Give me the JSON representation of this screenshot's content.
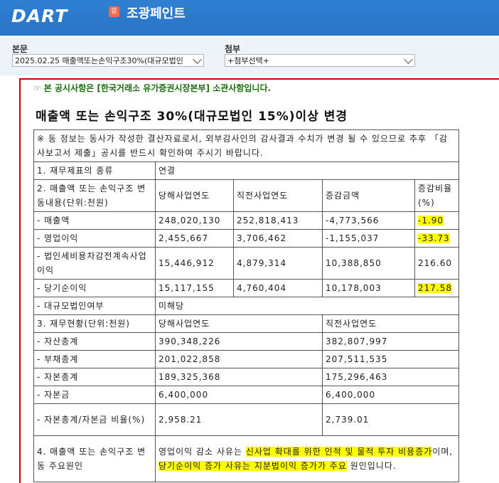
{
  "header": {
    "logo": "DART",
    "company_badge": "유",
    "company_name": "조광페인트"
  },
  "toolbar": {
    "body_label": "본문",
    "body_select": "2025.02.25 매출액또는손익구조30%(대규모법인",
    "attach_label": "첨부",
    "attach_select": "+첨부선택+"
  },
  "notice": {
    "icon": "☞",
    "text": "본 공시사항은 [한국거래소 유가증권시장본부] 소관사항입니다."
  },
  "doc_title": "매출액 또는 손익구조 30%(대규모법인 15%)이상 변경",
  "table": {
    "note": "※ 동 정보는 동사가 작성한 결산자료로서, 외부감사인의 감사결과 수치가 변경 될 수 있으므로 추후 「감사보고서 제출」공시를 반드시 확인하여 주시기 바랍니다.",
    "r1_label": "1. 재무제표의 종류",
    "r1_value": "연결",
    "r2_label": "2. 매출액 또는 손익구조 변동내용(단위:천원)",
    "h_curr": "당해사업연도",
    "h_prev": "직전사업연도",
    "h_diff": "증감금액",
    "h_rate": "증감비율(%)",
    "rows": [
      {
        "label": "- 매출액",
        "curr": "248,020,130",
        "prev": "252,818,413",
        "diff": "-4,773,566",
        "rate": "-1.90"
      },
      {
        "label": "- 영업이익",
        "curr": "2,455,667",
        "prev": "3,706,462",
        "diff": "-1,155,037",
        "rate": "-33.73"
      },
      {
        "label": "- 법인세비용차감전계속사업이익",
        "curr": "15,446,912",
        "prev": "4,879,314",
        "diff": "10,388,850",
        "rate": "216.60"
      },
      {
        "label": "- 당기순이익",
        "curr": "15,117,155",
        "prev": "4,760,404",
        "diff": "10,178,003",
        "rate": "217.58"
      }
    ],
    "large_label": "- 대규모법인여부",
    "large_value": "미해당",
    "r3_label": "3. 재무현황(단위:천원)",
    "r3_curr": "당해사업연도",
    "r3_prev": "직전사업연도",
    "fin": [
      {
        "label": "- 자산총계",
        "curr": "390,348,226",
        "prev": "382,807,997"
      },
      {
        "label": "- 부채총계",
        "curr": "201,022,858",
        "prev": "207,511,535"
      },
      {
        "label": "- 자본총계",
        "curr": "189,325,368",
        "prev": "175,296,463"
      },
      {
        "label": "- 자본금",
        "curr": "6,400,000",
        "prev": "6,400,000"
      },
      {
        "label": "- 자본총계/자본금 비율(%)",
        "curr": "2,958.21",
        "prev": "2,739.01"
      }
    ],
    "r4_label": "4. 매출액 또는 손익구조 변동 주요원인",
    "r4_a": "영업이익 감소 사유는 ",
    "r4_b": "신사업 확대를 위한 인적 및 물적 투자 비용증가",
    "r4_c": "이며, ",
    "r4_d": "당기순이익 증가 사유는 지분법이익 증가가 주요",
    "r4_e": " 원인입니다."
  }
}
